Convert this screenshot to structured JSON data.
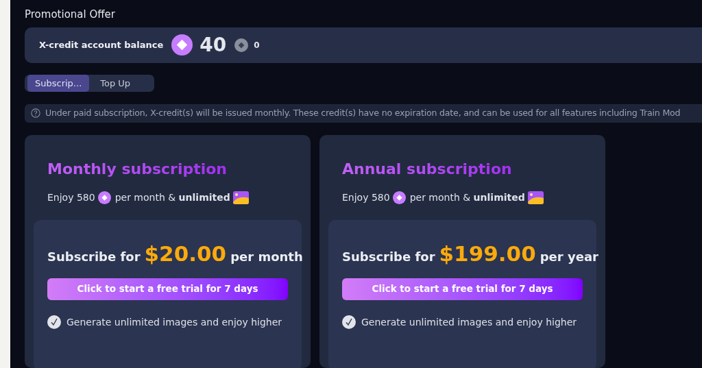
{
  "title": "Promotional Offer",
  "balance": {
    "label": "X-credit account balance",
    "amount": "40",
    "secondary": "0"
  },
  "tabs": [
    {
      "label": "Subscrip...",
      "selected": true
    },
    {
      "label": "Top Up",
      "selected": false
    }
  ],
  "notice": "Under paid subscription, X-credit(s) will be issued monthly. These credit(s) have no expiration date, and can be used for all features including Train Mod",
  "plans": [
    {
      "title": "Monthly subscription",
      "enjoy": "Enjoy 580",
      "enjoy_rest": "per month & **unlimited**",
      "prefix": "Subscribe for",
      "price": "$20.00",
      "period": "per month",
      "button": "Click to start a free trial for 7 days",
      "features": [
        {
          "text": "Generate unlimited images and enjoy higher",
          "checked": true
        }
      ]
    },
    {
      "title": "Annual subscription",
      "enjoy": "Enjoy 580",
      "enjoy_rest": "per month & **unlimited**",
      "prefix": "Subscribe for",
      "price": "$199.00",
      "period": "per year",
      "button": "Click to start a free trial for 7 days",
      "features": [
        {
          "text": "Generate unlimited images and enjoy higher",
          "checked": true
        }
      ]
    }
  ]
}
